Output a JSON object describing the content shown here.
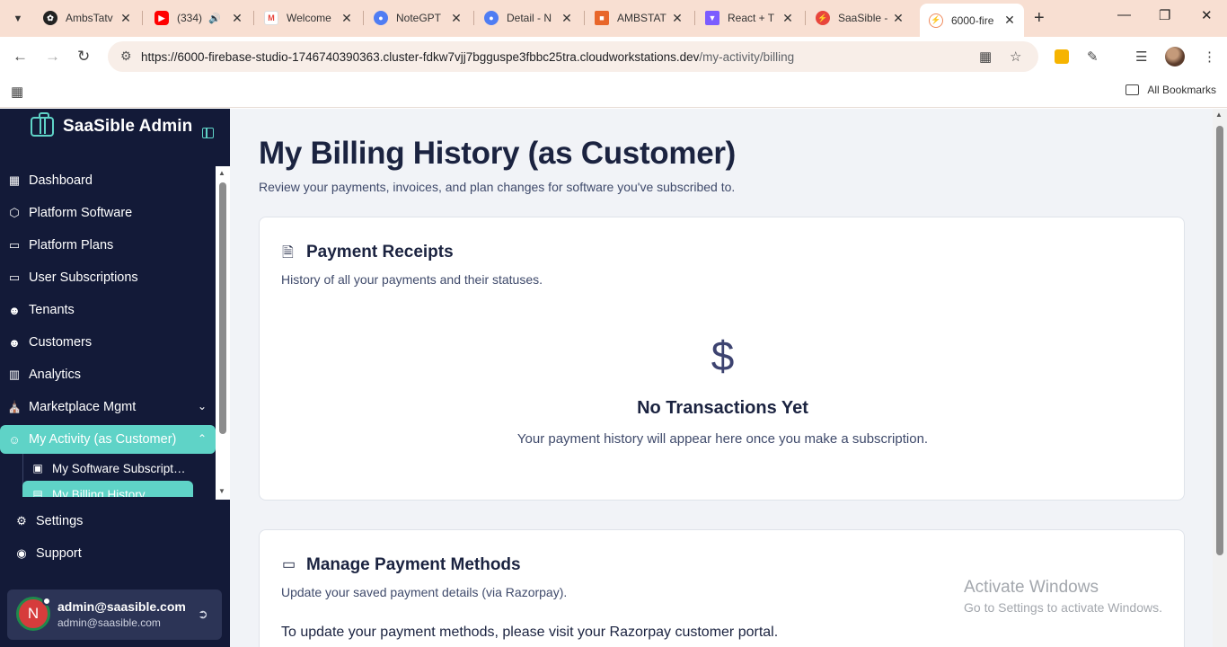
{
  "browser": {
    "tabs": [
      {
        "title": "AmbsTatv",
        "fav_color": "#222222"
      },
      {
        "title": "(334)",
        "fav_color": "#ff0000"
      },
      {
        "title": "Welcome",
        "fav_color": "#e8453c"
      },
      {
        "title": "NoteGPT",
        "fav_color": "#4f7df3"
      },
      {
        "title": "Detail - N",
        "fav_color": "#4f7df3"
      },
      {
        "title": "AMBSTAT",
        "fav_color": "#e8662a"
      },
      {
        "title": "React + T",
        "fav_color": "#7b5cff"
      },
      {
        "title": "SaaSible -",
        "fav_color": "#e8453c"
      },
      {
        "title": "6000-fire",
        "fav_color": "#f08a5d"
      }
    ],
    "url_host": "https://6000-firebase-studio-1746740390363.cluster-fdkw7vjj7bgguspe3fbbc25tra.cloudworkstations.dev",
    "url_path": "/my-activity/billing",
    "bookmarks_label": "All Bookmarks"
  },
  "sidebar": {
    "brand": "SaaSible Admin",
    "items": [
      {
        "label": "Dashboard",
        "icon": "grid-icon"
      },
      {
        "label": "Platform Software",
        "icon": "package-icon"
      },
      {
        "label": "Platform Plans",
        "icon": "card-icon"
      },
      {
        "label": "User Subscriptions",
        "icon": "card-icon"
      },
      {
        "label": "Tenants",
        "icon": "user-icon"
      },
      {
        "label": "Customers",
        "icon": "user-icon"
      },
      {
        "label": "Analytics",
        "icon": "bar-chart-icon"
      },
      {
        "label": "Marketplace Mgmt",
        "icon": "store-icon"
      },
      {
        "label": "My Activity (as Customer)",
        "icon": "user-circle-icon"
      }
    ],
    "sub_items": [
      {
        "label": "My Software Subscriptions"
      },
      {
        "label": "My Billing History"
      }
    ],
    "bottom": [
      {
        "label": "Settings",
        "icon": "gear-icon"
      },
      {
        "label": "Support",
        "icon": "lifebuoy-icon"
      }
    ],
    "user": {
      "initial": "N",
      "name": "admin@saasible.com",
      "email": "admin@saasible.com"
    }
  },
  "main": {
    "title": "My Billing History (as Customer)",
    "subtitle": "Review your payments, invoices, and plan changes for software you've subscribed to.",
    "receipts": {
      "title": "Payment Receipts",
      "desc": "History of all your payments and their statuses.",
      "empty_icon": "$",
      "empty_title": "No Transactions Yet",
      "empty_desc": "Your payment history will appear here once you make a subscription."
    },
    "methods": {
      "title": "Manage Payment Methods",
      "desc": "Update your saved payment details (via Razorpay).",
      "body": "To update your payment methods, please visit your Razorpay customer portal."
    }
  },
  "watermark": {
    "line1": "Activate Windows",
    "line2": "Go to Settings to activate Windows."
  }
}
